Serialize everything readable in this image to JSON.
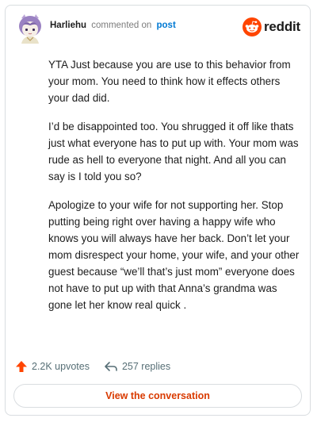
{
  "header": {
    "author": "Harliehu",
    "action": "commented on",
    "link": "post",
    "brand": "reddit"
  },
  "comment": {
    "paragraphs": [
      "YTA Just because you are use to this behavior from your mom. You need to think how it effects others your dad did.",
      "I’d be disappointed too. You shrugged it off like thats just what everyone has to put up with. Your mom was rude as hell to everyone that night. And all you can say is I told you so?",
      "Apologize to your wife for not supporting her. Stop putting being right over having a happy wife who knows you will always have her back. Don’t let your mom disrespect your home, your wife, and your other guest because “we’ll that’s just mom” everyone does not have to put up with that Anna’s grandma was gone let her know real quick ."
    ]
  },
  "footer": {
    "upvotes": "2.2K upvotes",
    "replies": "257 replies"
  },
  "cta": {
    "label": "View the conversation"
  },
  "colors": {
    "reddit_orange": "#ff4500",
    "link_blue": "#0079d3",
    "cta_text": "#d93a00",
    "muted": "#576f76"
  },
  "icons": {
    "avatar": "anime-avatar",
    "brand": "reddit-snoo-icon",
    "upvote": "upvote-arrow-icon",
    "reply": "reply-arrow-icon"
  }
}
